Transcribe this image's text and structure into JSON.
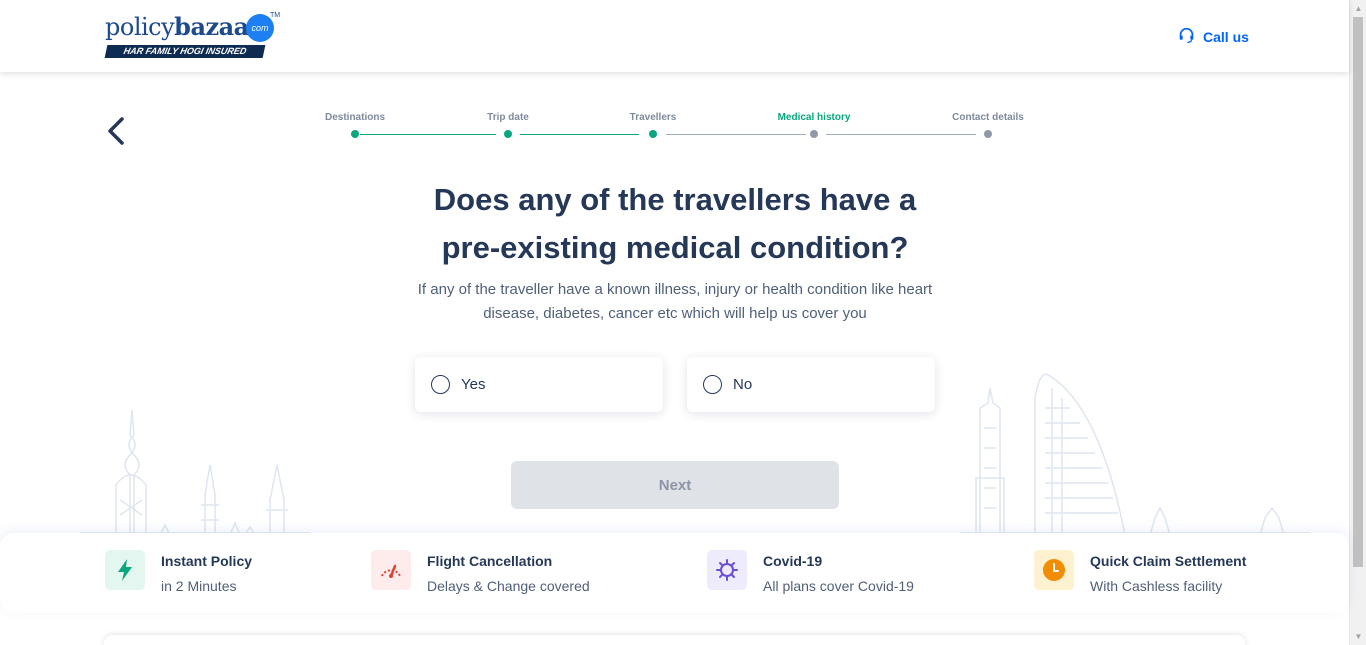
{
  "header": {
    "logo": {
      "word_light": "policy",
      "word_bold": "bazaar",
      "com": "com",
      "tm": "TM",
      "tagline": "HAR FAMILY HOGI INSURED"
    },
    "call_label": "Call us"
  },
  "stepper": {
    "steps": [
      {
        "label": "Destinations",
        "state": "done"
      },
      {
        "label": "Trip date",
        "state": "done"
      },
      {
        "label": "Travellers",
        "state": "done"
      },
      {
        "label": "Medical history",
        "state": "active"
      },
      {
        "label": "Contact details",
        "state": "todo"
      }
    ]
  },
  "question": {
    "line1": "Does any of the travellers have a",
    "line2": "pre-existing medical condition?",
    "subtext_line1": "If any of the traveller have a known illness, injury or health condition like heart",
    "subtext_line2": "disease, diabetes, cancer etc which will help us cover you"
  },
  "options": [
    {
      "label": "Yes",
      "selected": false
    },
    {
      "label": "No",
      "selected": false
    }
  ],
  "next_label": "Next",
  "features": [
    {
      "icon": "lightning-icon",
      "title": "Instant Policy",
      "subtitle": "in 2 Minutes",
      "bg": "#e3f7f0",
      "fg": "#0aa67f"
    },
    {
      "icon": "flight-cancel-icon",
      "title": "Flight Cancellation",
      "subtitle": "Delays & Change covered",
      "bg": "#fdeceb",
      "fg": "#e0402f"
    },
    {
      "icon": "virus-icon",
      "title": "Covid-19",
      "subtitle": "All plans cover Covid-19",
      "bg": "#eeebfb",
      "fg": "#6a4fd8"
    },
    {
      "icon": "clock-icon",
      "title": "Quick Claim Settlement",
      "subtitle": "With Cashless facility",
      "bg": "#fdf1cf",
      "fg": "#f28c00"
    }
  ],
  "colors": {
    "primary_text": "#253858",
    "accent_green": "#0aa67f",
    "link_blue": "#0065ff"
  }
}
